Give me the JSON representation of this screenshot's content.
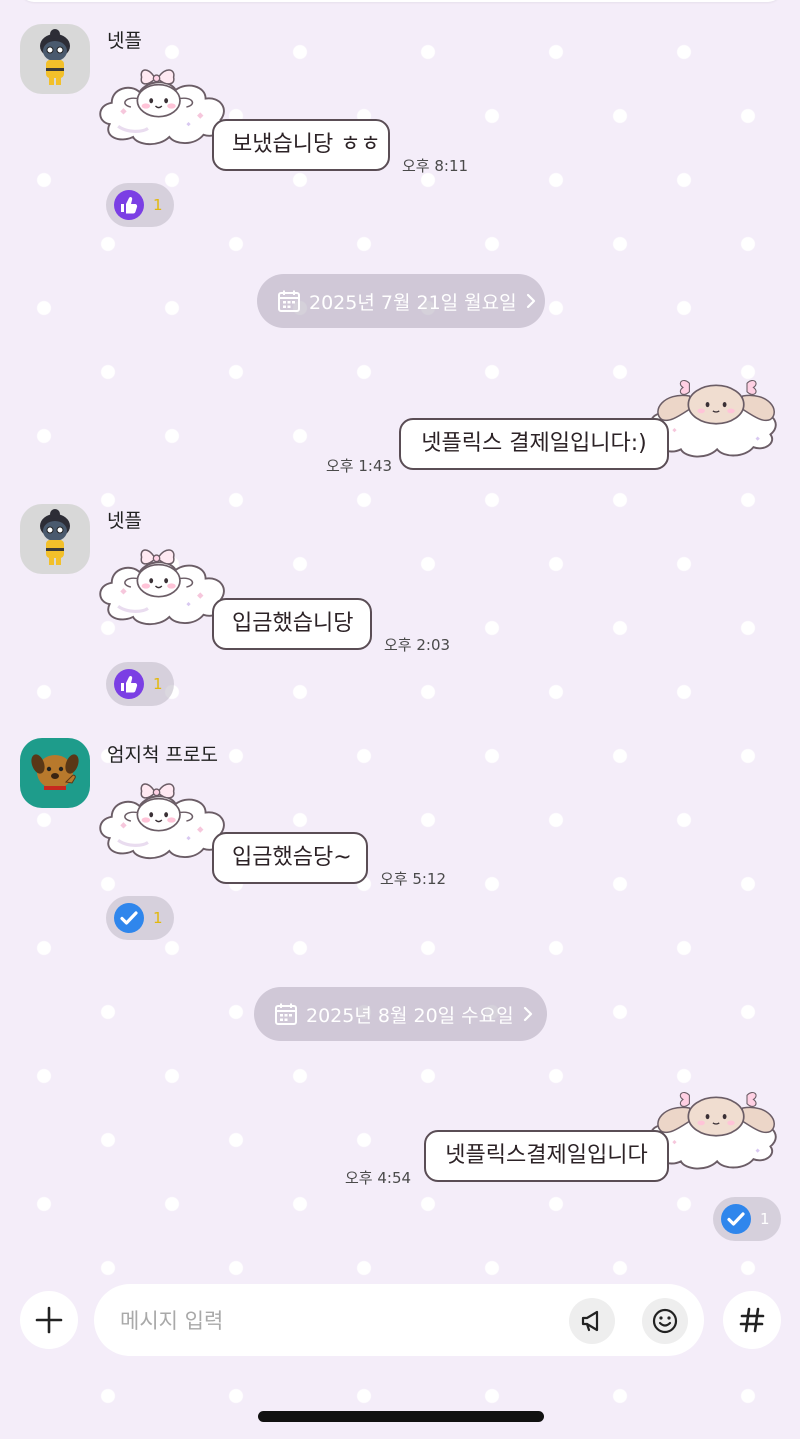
{
  "colors": {
    "background": "#f4edf9",
    "bubble_border": "#5a4d55",
    "like_accent": "#7b3fe4",
    "check_accent": "#2f86ec",
    "reaction_count_yellow": "#e2b80d"
  },
  "messages": [
    {
      "type": "incoming",
      "sender": "넷플",
      "avatar_icon": "ninja-character-avatar-icon",
      "sticker_icon": "cinnamoroll-cloud-sticker-icon",
      "text": "보냈습니당 ㅎㅎ",
      "time": "오후 8:11",
      "reaction": {
        "icon": "thumbs-up-icon",
        "count": "1"
      }
    },
    {
      "type": "date",
      "label": "2025년 7월 21일 월요일"
    },
    {
      "type": "outgoing",
      "sticker_icon": "bunny-cloud-sticker-icon",
      "text": "넷플릭스 결제일입니다:)",
      "time": "오후 1:43"
    },
    {
      "type": "incoming",
      "sender": "넷플",
      "avatar_icon": "ninja-character-avatar-icon",
      "sticker_icon": "cinnamoroll-cloud-sticker-icon",
      "text": "입금했습니당",
      "time": "오후 2:03",
      "reaction": {
        "icon": "thumbs-up-icon",
        "count": "1"
      }
    },
    {
      "type": "incoming",
      "sender": "엄지척 프로도",
      "avatar_icon": "dog-character-avatar-icon",
      "sticker_icon": "cinnamoroll-cloud-sticker-icon",
      "text": "입금했슴당~",
      "time": "오후 5:12",
      "reaction": {
        "icon": "check-icon",
        "count": "1"
      }
    },
    {
      "type": "date",
      "label": "2025년 8월 20일 수요일"
    },
    {
      "type": "outgoing",
      "sticker_icon": "bunny-cloud-sticker-icon",
      "text": "넷플릭스결제일입니다",
      "time": "오후 4:54",
      "reaction": {
        "icon": "check-icon",
        "count": "1"
      }
    }
  ],
  "input_bar": {
    "placeholder": "메시지 입력",
    "add_icon": "plus-icon",
    "announce_icon": "megaphone-icon",
    "emoji_icon": "smiley-icon",
    "hashtag_icon": "hashtag-icon"
  }
}
